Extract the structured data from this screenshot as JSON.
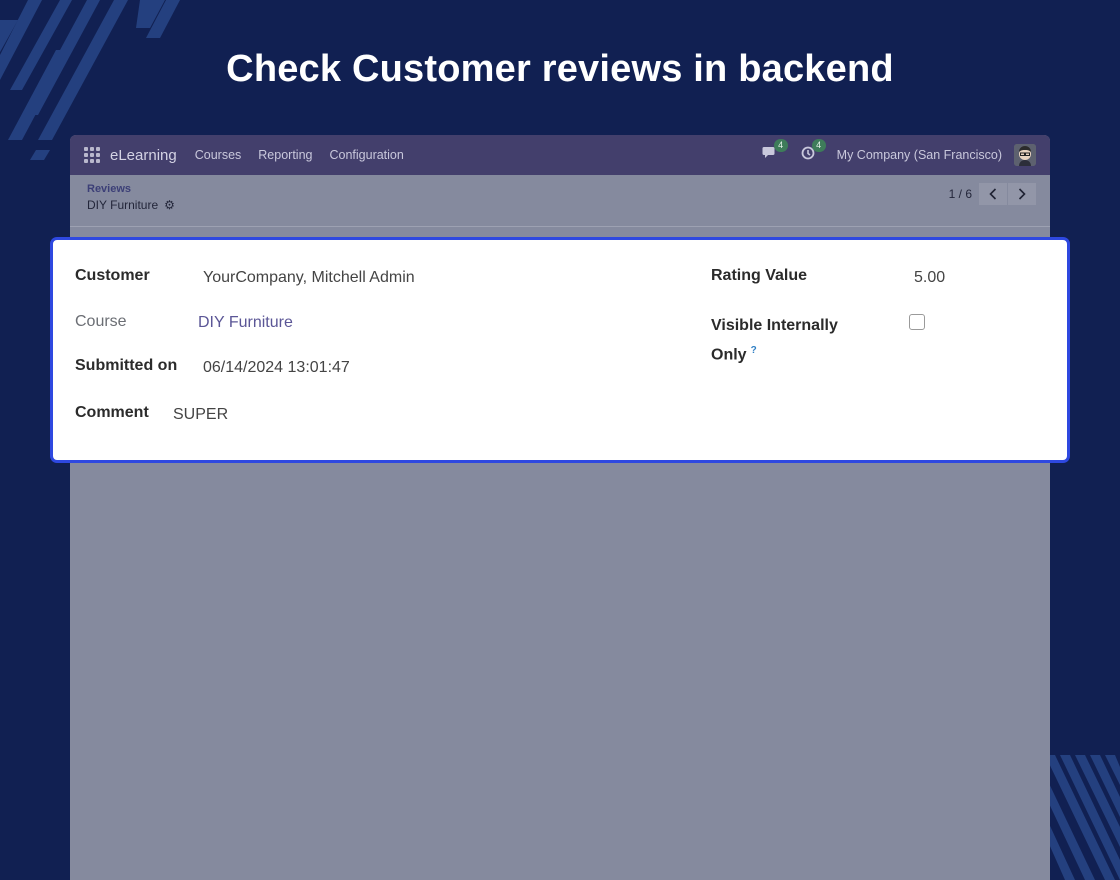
{
  "headline": "Check Customer reviews in backend",
  "navbar": {
    "app_name": "eLearning",
    "menu": [
      "Courses",
      "Reporting",
      "Configuration"
    ],
    "messages_count": "4",
    "activities_count": "4",
    "company": "My Company (San Francisco)"
  },
  "breadcrumb": {
    "parent": "Reviews",
    "current": "DIY Furniture"
  },
  "pager": {
    "value": "1 / 6",
    "prev_label": "‹",
    "next_label": "›"
  },
  "form": {
    "customer_label": "Customer",
    "customer_value": "YourCompany, Mitchell Admin",
    "course_label": "Course",
    "course_value": "DIY Furniture",
    "submitted_label": "Submitted on",
    "submitted_value": "06/14/2024 13:01:47",
    "comment_label": "Comment",
    "comment_value": "SUPER",
    "rating_label": "Rating Value",
    "rating_value": "5.00",
    "visible_label_line1": "Visible Internally",
    "visible_label_line2": "Only",
    "visible_help": "?",
    "visible_checked": false
  },
  "colors": {
    "background": "#112052",
    "navbar": "#433f6c",
    "highlight_border": "#2e48e0",
    "link": "#5b5696",
    "badge": "#3e7c5a"
  },
  "icons": [
    "apps-grid-icon",
    "chat-icon",
    "clock-icon",
    "avatar",
    "gear-icon",
    "chevron-left-icon",
    "chevron-right-icon"
  ]
}
